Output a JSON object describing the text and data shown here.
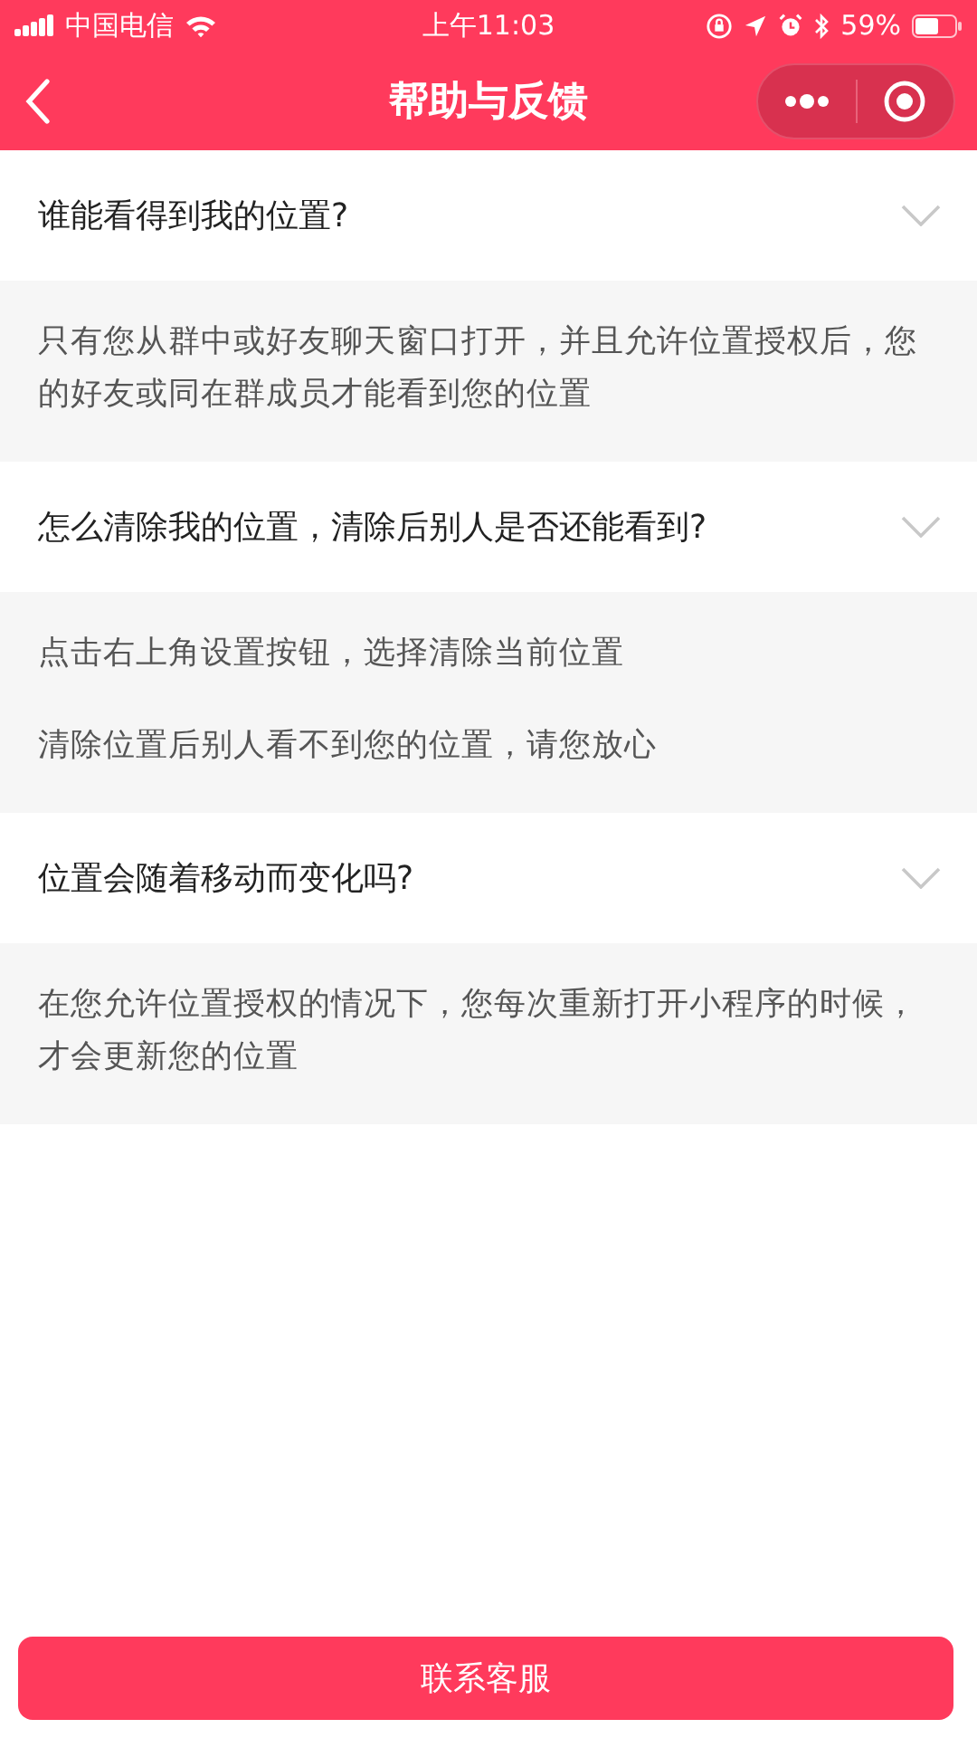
{
  "status_bar": {
    "carrier": "中国电信",
    "time": "上午11:03",
    "battery": "59%"
  },
  "nav_bar": {
    "title": "帮助与反馈"
  },
  "faq": [
    {
      "question": "谁能看得到我的位置?",
      "answer": [
        "只有您从群中或好友聊天窗口打开，并且允许位置授权后，您的好友或同在群成员才能看到您的位置"
      ]
    },
    {
      "question": "怎么清除我的位置，清除后别人是否还能看到?",
      "answer": [
        "点击右上角设置按钮，选择清除当前位置",
        "清除位置后别人看不到您的位置，请您放心"
      ]
    },
    {
      "question": "位置会随着移动而变化吗?",
      "answer": [
        "在您允许位置授权的情况下，您每次重新打开小程序的时候，才会更新您的位置"
      ]
    }
  ],
  "contact_button": "联系客服"
}
